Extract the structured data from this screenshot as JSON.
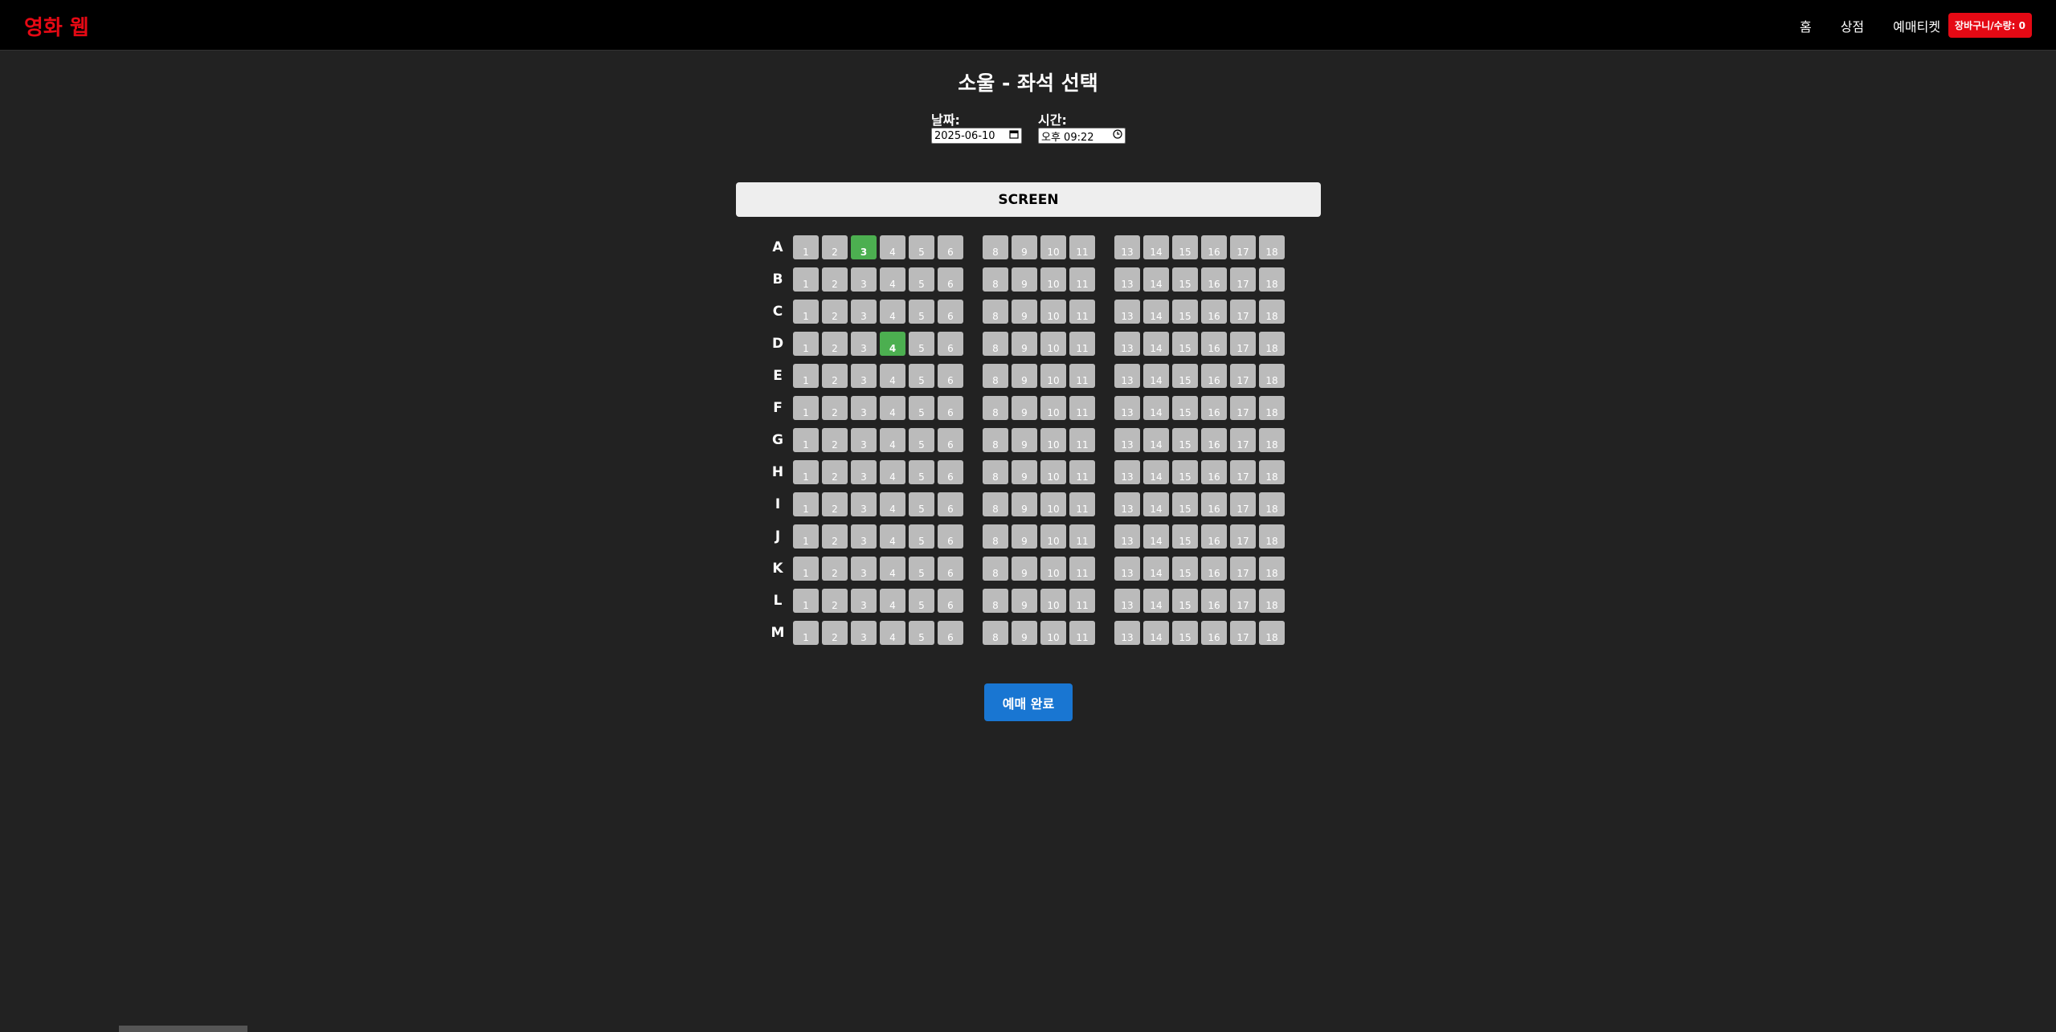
{
  "app": {
    "logo": "영화 웹"
  },
  "nav": {
    "items": [
      "홈",
      "상점",
      "예매티켓"
    ],
    "cart_label": "장바구니/수량: 0"
  },
  "page": {
    "title": "소울 - 좌석 선택"
  },
  "date_field": {
    "label": "날짜:",
    "value": "2025-06-10"
  },
  "time_field": {
    "label": "시간:",
    "value": "오후 09:22"
  },
  "screen_label": "SCREEN",
  "seating": {
    "rows": [
      "A",
      "B",
      "C",
      "D",
      "E",
      "F",
      "G",
      "H",
      "I",
      "J",
      "K",
      "L",
      "M"
    ],
    "seat_numbers": [
      1,
      2,
      3,
      4,
      5,
      6,
      8,
      9,
      10,
      11,
      13,
      14,
      15,
      16,
      17,
      18
    ],
    "selected": [
      {
        "row": "A",
        "seat": 3
      },
      {
        "row": "D",
        "seat": 4
      }
    ],
    "colors": {
      "available": "#bbbbbb",
      "selected": "#4caf50"
    }
  },
  "actions": {
    "complete_label": "예매 완료"
  }
}
